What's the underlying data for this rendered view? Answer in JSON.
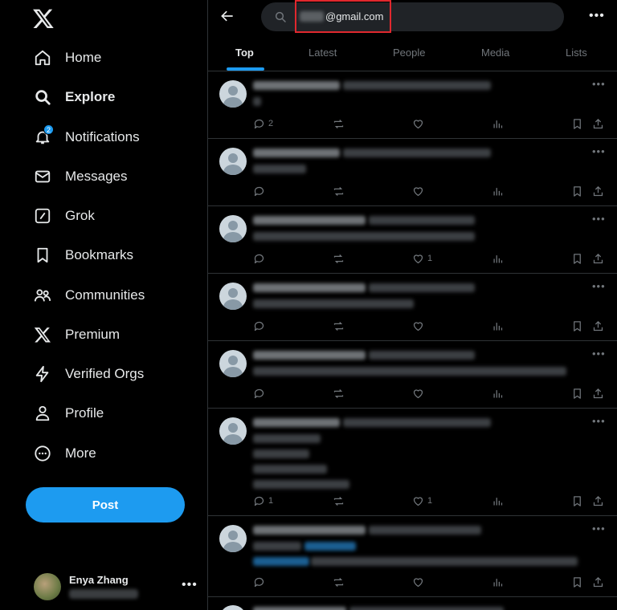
{
  "sidebar": {
    "logo": "x-logo-icon",
    "nav": [
      {
        "label": "Home",
        "icon": "home-icon"
      },
      {
        "label": "Explore",
        "icon": "search-icon",
        "active": true
      },
      {
        "label": "Notifications",
        "icon": "bell-icon",
        "badge": "2"
      },
      {
        "label": "Messages",
        "icon": "envelope-icon"
      },
      {
        "label": "Grok",
        "icon": "grok-icon"
      },
      {
        "label": "Bookmarks",
        "icon": "bookmark-icon"
      },
      {
        "label": "Communities",
        "icon": "people-icon"
      },
      {
        "label": "Premium",
        "icon": "x-logo-icon"
      },
      {
        "label": "Verified Orgs",
        "icon": "lightning-icon"
      },
      {
        "label": "Profile",
        "icon": "person-icon"
      },
      {
        "label": "More",
        "icon": "more-circle-icon"
      }
    ],
    "post_label": "Post",
    "account": {
      "name": "Enya Zhang",
      "more": "•••"
    }
  },
  "main": {
    "search": {
      "visible_text": "@gmail.com"
    },
    "more": "•••",
    "tabs": [
      {
        "label": "Top",
        "active": true
      },
      {
        "label": "Latest"
      },
      {
        "label": "People"
      },
      {
        "label": "Media"
      },
      {
        "label": "Lists"
      }
    ],
    "tweets": [
      {
        "replies": "2",
        "likes": ""
      },
      {
        "replies": "",
        "likes": ""
      },
      {
        "replies": "",
        "likes": "1"
      },
      {
        "replies": "",
        "likes": ""
      },
      {
        "replies": "",
        "likes": ""
      },
      {
        "replies": "1",
        "likes": "1"
      },
      {
        "replies": "",
        "likes": ""
      }
    ]
  },
  "colors": {
    "accent": "#1d9bf0",
    "background": "#000000",
    "text": "#e7e9ea",
    "muted": "#71767b",
    "border": "#2f3336",
    "highlight": "#e0282e"
  }
}
